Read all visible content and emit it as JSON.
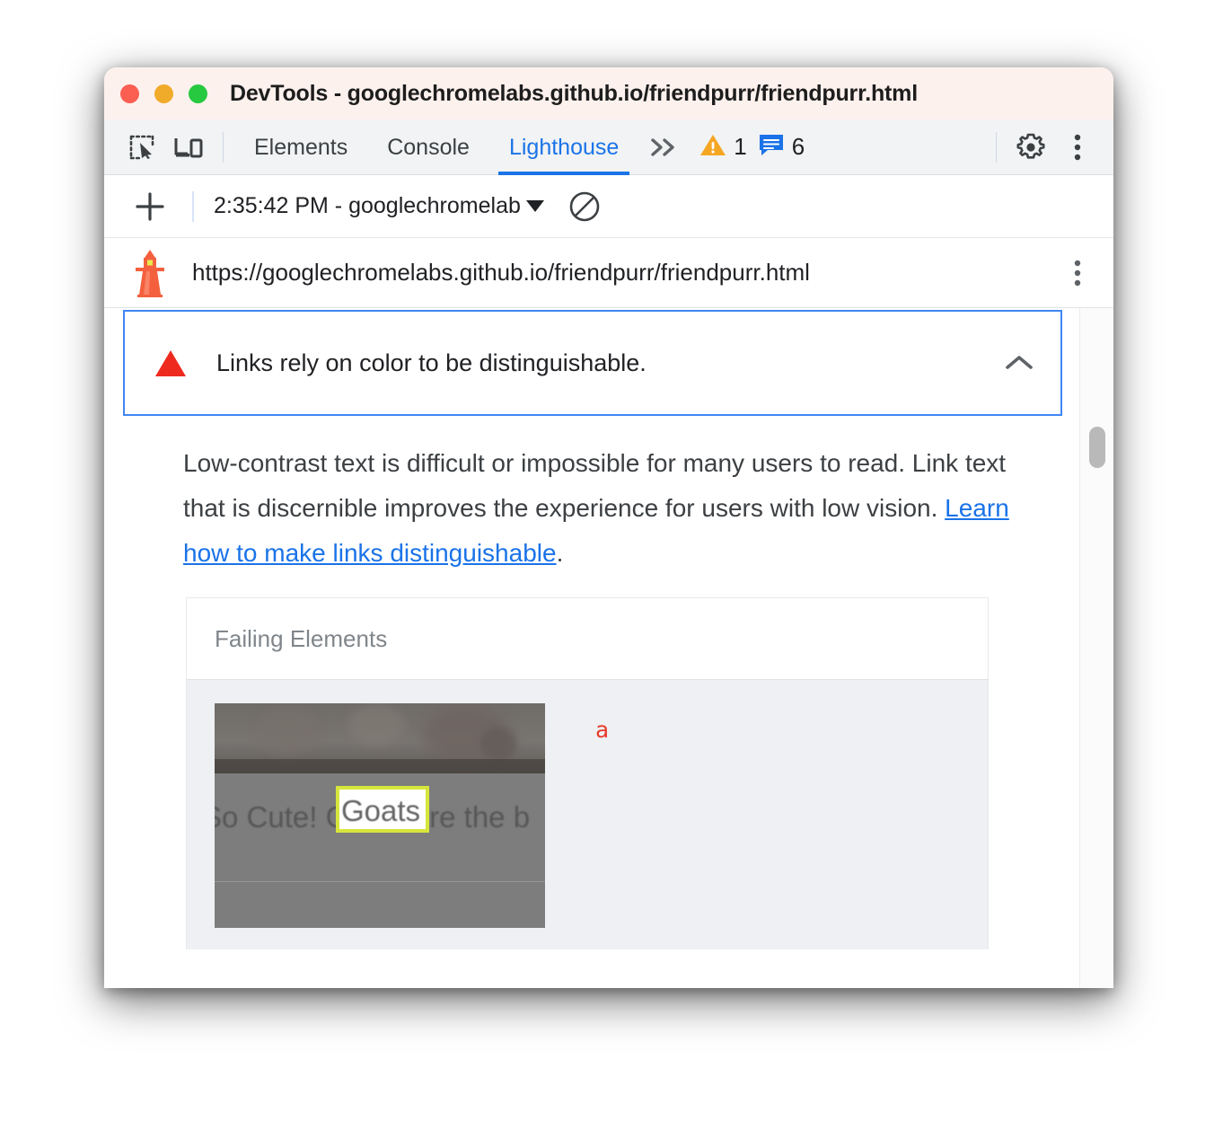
{
  "window": {
    "title": "DevTools - googlechromelabs.github.io/friendpurr/friendpurr.html",
    "traffic_lights": [
      {
        "name": "close",
        "color": "#fb5f52"
      },
      {
        "name": "minimize",
        "color": "#f0ab2a"
      },
      {
        "name": "zoom",
        "color": "#26c93f"
      }
    ]
  },
  "tabbar": {
    "inspect_icon": "inspect-element-icon",
    "device_icon": "device-toolbar-icon",
    "tabs": [
      {
        "label": "Elements",
        "active": false
      },
      {
        "label": "Console",
        "active": false
      },
      {
        "label": "Lighthouse",
        "active": true
      }
    ],
    "more_tabs_icon": "chevron-double-right-icon",
    "warnings": {
      "icon": "warning-triangle-icon",
      "count": "1",
      "color": "#f29900"
    },
    "messages": {
      "icon": "message-icon",
      "count": "6",
      "color": "#1a73e8"
    },
    "settings_icon": "gear-icon",
    "menu_icon": "kebab-menu-icon",
    "active_color": "#1a73e8"
  },
  "runbar": {
    "new_report_icon": "plus-icon",
    "report_select_label": "2:35:42 PM - googlechromelab",
    "dropdown_icon": "caret-down-icon",
    "clear_icon": "clear-all-icon"
  },
  "urlbar": {
    "lighthouse_icon": "lighthouse-logo-icon",
    "url": "https://googlechromelabs.github.io/friendpurr/friendpurr.html",
    "menu_icon": "kebab-menu-icon"
  },
  "audit": {
    "severity_icon": "red-triangle-fail-icon",
    "severity_color": "#ee2a1f",
    "title": "Links rely on color to be distinguishable.",
    "collapse_icon": "chevron-up-icon",
    "border_color": "#4285f4",
    "description_part1": "Low-contrast text is difficult or impossible for many users to read. Link text that is discernible improves the experience for users with low vision. ",
    "description_link": "Learn how to make links distinguishable",
    "description_part2": ".",
    "link_color": "#1a73e8"
  },
  "failing_elements": {
    "header": "Failing Elements",
    "rows": [
      {
        "thumbnail_caption": "So Cute! Goats are the b",
        "highlighted_text": "Goats",
        "highlight_color": "#d7e63b",
        "node_snippet": "a",
        "node_snippet_color": "#e8392a"
      }
    ]
  },
  "scrollbar": {
    "name": "vertical-scrollbar",
    "thumb_color": "#b9b9b9"
  }
}
